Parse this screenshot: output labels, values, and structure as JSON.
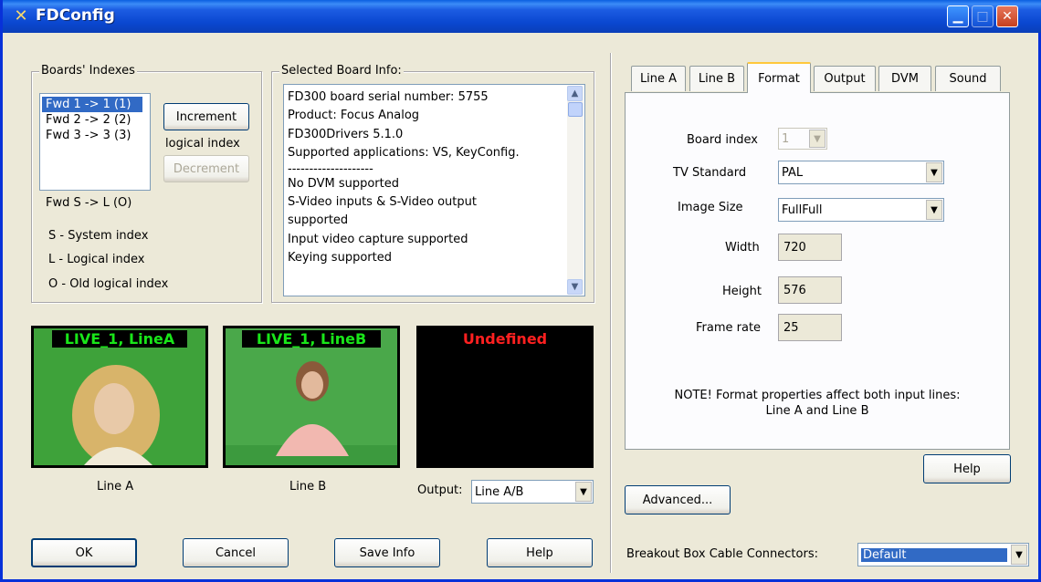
{
  "window": {
    "title": "FDConfig",
    "icon": "tools-icon"
  },
  "boards": {
    "group_label": "Boards' Indexes",
    "items": [
      "Fwd 1 -> 1 (1)",
      "Fwd 2 -> 2 (2)",
      "Fwd 3 -> 3 (3)"
    ],
    "selected": 0,
    "increment": "Increment",
    "logical_index": "logical index",
    "decrement": "Decrement",
    "legend_format": "Fwd S -> L (O)",
    "legend_s": "S - System index",
    "legend_l": "L - Logical index",
    "legend_o": "O - Old logical index"
  },
  "info": {
    "group_label": "Selected Board Info:",
    "lines": [
      "FD300 board serial number: 5755",
      "Product: Focus Analog",
      "FD300Drivers 5.1.0",
      "Supported applications: VS, KeyConfig.",
      "--------------------",
      "No DVM supported",
      "S-Video inputs & S-Video output",
      "supported",
      "Input video capture supported",
      "Keying supported"
    ]
  },
  "previews": {
    "a_label": "LIVE_1, LineA",
    "b_label": "LIVE_1, LineB",
    "out_label": "Undefined",
    "a_caption": "Line A",
    "b_caption": "Line B",
    "output_label": "Output:",
    "output_value": "Line A/B"
  },
  "buttons": {
    "ok": "OK",
    "cancel": "Cancel",
    "save_info": "Save Info",
    "help": "Help",
    "help2": "Help",
    "advanced": "Advanced..."
  },
  "tabs": [
    "Line A",
    "Line B",
    "Format",
    "Output",
    "DVM",
    "Sound"
  ],
  "active_tab": "Format",
  "format": {
    "board_index_label": "Board index",
    "board_index_value": "1",
    "tv_standard_label": "TV Standard",
    "tv_standard_value": "PAL",
    "image_size_label": "Image Size",
    "image_size_value": "FullFull",
    "width_label": "Width",
    "width_value": "720",
    "height_label": "Height",
    "height_value": "576",
    "frame_rate_label": "Frame rate",
    "frame_rate_value": "25",
    "note_line1": "NOTE! Format properties affect both input lines:",
    "note_line2": "Line A and Line B"
  },
  "breakout": {
    "label": "Breakout Box Cable Connectors:",
    "value": "Default"
  },
  "colors": {
    "title_bar": "#0a47d0",
    "green_screen": "#3ea23a",
    "label_green": "#19e619",
    "label_red": "#ff2020",
    "selection": "#316ac5"
  }
}
